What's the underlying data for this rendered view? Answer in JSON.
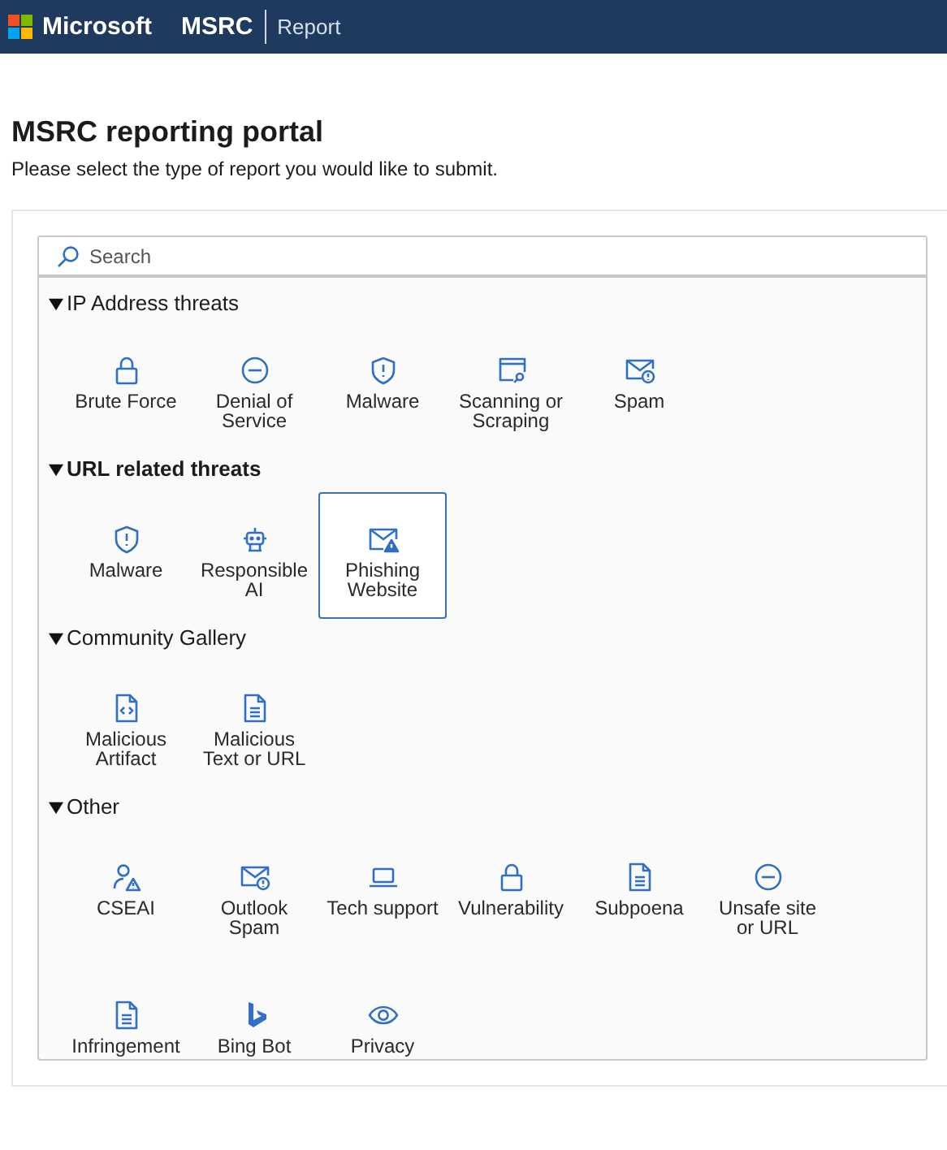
{
  "header": {
    "brand": "Microsoft",
    "product": "MSRC",
    "section": "Report"
  },
  "title": "MSRC reporting portal",
  "subtitle": "Please select the type of report you would like to submit.",
  "search": {
    "placeholder": "Search"
  },
  "groups": [
    {
      "label": "IP Address threats",
      "expanded": true,
      "items": [
        {
          "label": "Brute Force",
          "selected": false
        },
        {
          "label": "Denial of\nService",
          "selected": false
        },
        {
          "label": "Malware",
          "selected": false
        },
        {
          "label": "Scanning or\nScraping",
          "selected": false
        },
        {
          "label": "Spam",
          "selected": false
        }
      ]
    },
    {
      "label": "URL related threats",
      "expanded": true,
      "items": [
        {
          "label": "Malware",
          "selected": false
        },
        {
          "label": "Responsible\nAI",
          "selected": false
        },
        {
          "label": "Phishing\nWebsite",
          "selected": true
        }
      ]
    },
    {
      "label": "Community Gallery",
      "expanded": true,
      "items": [
        {
          "label": "Malicious\nArtifact",
          "selected": false
        },
        {
          "label": "Malicious\nText or URL",
          "selected": false
        }
      ]
    },
    {
      "label": "Other",
      "expanded": true,
      "items": [
        {
          "label": "CSEAI",
          "selected": false
        },
        {
          "label": "Outlook\nSpam",
          "selected": false
        },
        {
          "label": "Tech support",
          "selected": false
        },
        {
          "label": "Vulnerability",
          "selected": false
        },
        {
          "label": "Subpoena",
          "selected": false
        },
        {
          "label": "Unsafe site\nor URL",
          "selected": false
        },
        {
          "label": "Infringement",
          "selected": false
        },
        {
          "label": "Bing Bot",
          "selected": false
        },
        {
          "label": "Privacy",
          "selected": false
        }
      ]
    }
  ]
}
